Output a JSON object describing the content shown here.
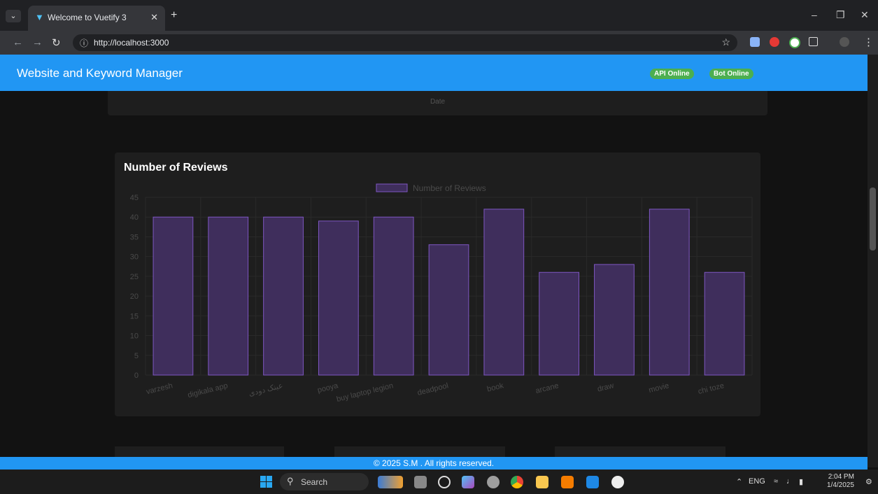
{
  "browser": {
    "tab_title": "Welcome to Vuetify 3",
    "url": "http://localhost:3000"
  },
  "app": {
    "title": "Website and Keyword Manager",
    "status": {
      "api": "API Online",
      "bot": "Bot Online"
    }
  },
  "previous_chart": {
    "xlabel": "Date"
  },
  "chart_card": {
    "title": "Number of Reviews"
  },
  "chart_data": {
    "type": "bar",
    "title": "Number of Reviews",
    "categories": [
      "varzesh",
      "digikala app",
      "عینک دودی",
      "pooya",
      "buy laptop legion",
      "deadpool",
      "book",
      "arcane",
      "draw",
      "movie",
      "chi toze"
    ],
    "series": [
      {
        "name": "Number of Reviews",
        "values": [
          40,
          40,
          40,
          39,
          40,
          33,
          42,
          26,
          28,
          42,
          26
        ]
      }
    ],
    "ylim": [
      0,
      45
    ],
    "yticks": [
      0,
      5,
      10,
      15,
      20,
      25,
      30,
      35,
      40,
      45
    ],
    "grid": true,
    "legend": "top-center",
    "colors": {
      "fill": "#3f2e5c",
      "stroke": "#7e57c2",
      "grid": "#2a2a2a",
      "tick": "#4a4a4a"
    }
  },
  "footer": {
    "text": "© 2025 S.M . All rights reserved."
  },
  "taskbar": {
    "search_placeholder": "Search",
    "lang": "ENG",
    "time": "2:04 PM",
    "date": "1/4/2025"
  },
  "colors": {
    "primary": "#2196f3",
    "success": "#4caf50",
    "background": "#121212",
    "card": "#1e1e1e"
  }
}
